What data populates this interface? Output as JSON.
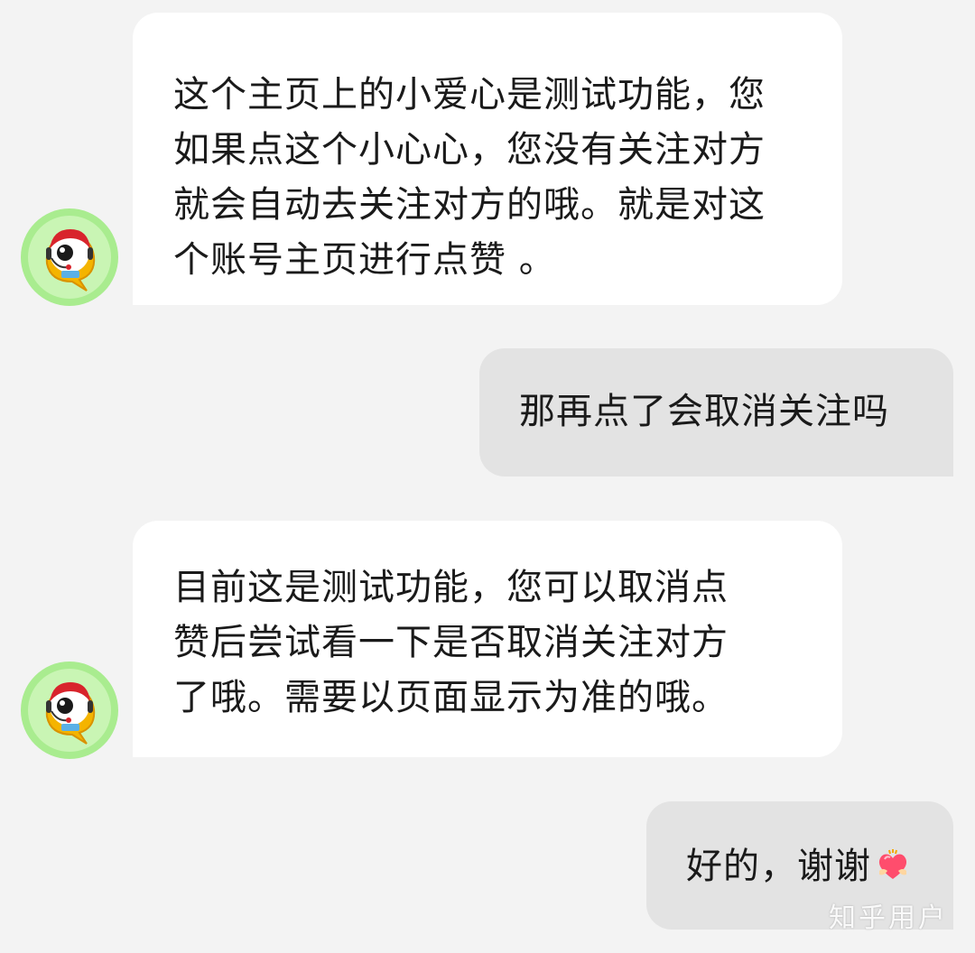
{
  "messages": [
    {
      "sender": "agent",
      "lines": [
        "这个主页上的小爱心是测试功能，您",
        "如果点这个小心心，您没有关注对方",
        "就会自动去关注对方的哦。就是对这",
        "个账号主页进行点赞 。"
      ]
    },
    {
      "sender": "user",
      "lines": [
        "那再点了会取消关注吗"
      ]
    },
    {
      "sender": "agent",
      "lines": [
        "目前这是测试功能，您可以取消点",
        "赞后尝试看一下是否取消关注对方",
        "了哦。需要以页面显示为准的哦。"
      ]
    },
    {
      "sender": "user",
      "lines": [
        "好的，谢谢"
      ],
      "emoji": "heart-emoji"
    }
  ],
  "watermark": "知乎用户",
  "colors": {
    "background": "#f3f3f3",
    "incoming_bubble": "#ffffff",
    "outgoing_bubble": "#e3e3e3",
    "avatar_ring": "#8fe07a"
  }
}
